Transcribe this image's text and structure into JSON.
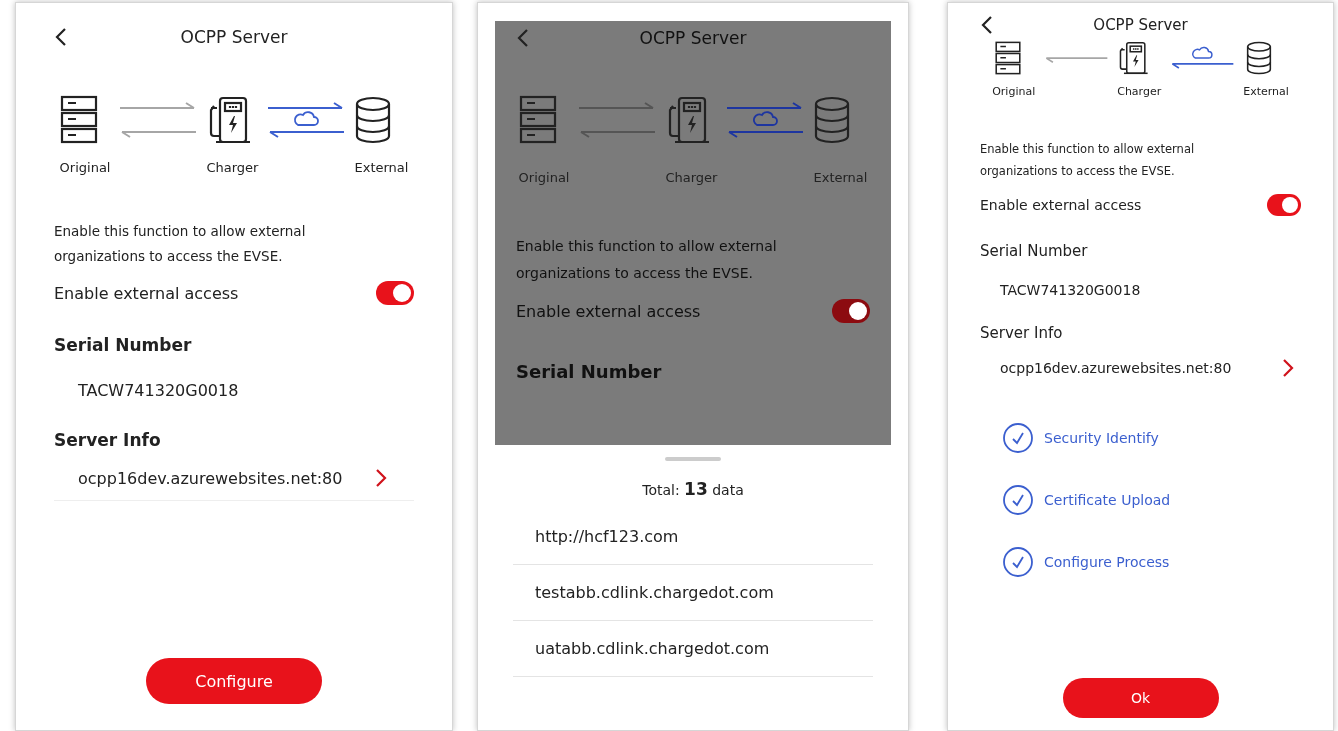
{
  "screens": [
    {
      "kind": "setup",
      "dimmed": false,
      "title": "OCPP Server",
      "diagram": {
        "two_way": true,
        "labels": [
          "Original",
          "Charger",
          "External"
        ]
      },
      "description": "Enable this function to allow external organizations to access the EVSE.",
      "toggle": {
        "label": "Enable external access",
        "on": true
      },
      "serial": {
        "label": "Serial Number",
        "value": "TACW741320G0018"
      },
      "server": {
        "label": "Server Info",
        "value": "ocpp16dev.azurewebsites.net:80"
      },
      "button": "Configure"
    },
    {
      "kind": "picker",
      "dimmed": true,
      "title": "OCPP Server",
      "diagram": {
        "two_way": true,
        "labels": [
          "Original",
          "Charger",
          "External"
        ]
      },
      "description": "Enable this function to allow external organizations to access the EVSE.",
      "toggle": {
        "label": "Enable external access",
        "on": true
      },
      "serial": {
        "label": "Serial Number"
      },
      "sheet": {
        "total": "Total: **13** data",
        "items": [
          "http://hcf123.com",
          "testabb.cdlink.chargedot.com",
          "uatabb.cdlink.chargedot.com"
        ]
      }
    },
    {
      "kind": "done",
      "dimmed": false,
      "title": "OCPP Server",
      "diagram": {
        "two_way": false,
        "labels": [
          "Original",
          "Charger",
          "External"
        ]
      },
      "description": "Enable this function to allow external organizations to access the EVSE.",
      "toggle": {
        "label": "Enable external access",
        "on": true
      },
      "serial": {
        "label": "Serial Number",
        "value": "TACW741320G0018"
      },
      "server": {
        "label": "Server Info",
        "value": "ocpp16dev.azurewebsites.net:80"
      },
      "steps": [
        {
          "label": "Security Identify",
          "checked": true
        },
        {
          "label": "Certificate Upload",
          "checked": true
        },
        {
          "label": "Configure Process",
          "checked": true
        }
      ],
      "button": "Ok"
    }
  ]
}
